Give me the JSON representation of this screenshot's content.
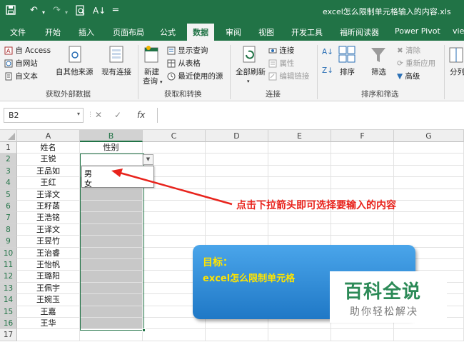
{
  "app": {
    "window_title": "excel怎么限制单元格输入的内容.xls",
    "quick_access": {
      "save_icon": "save-icon",
      "undo_icon": "undo-icon",
      "redo_icon": "redo-icon",
      "print_preview_icon": "print-preview-icon",
      "sort_icon": "sort-icon",
      "customize_icon": "customize-qat-icon"
    }
  },
  "tabs": [
    {
      "label": "文件"
    },
    {
      "label": "开始"
    },
    {
      "label": "插入"
    },
    {
      "label": "页面布局"
    },
    {
      "label": "公式"
    },
    {
      "label": "数据",
      "active": true
    },
    {
      "label": "审阅"
    },
    {
      "label": "视图"
    },
    {
      "label": "开发工具"
    },
    {
      "label": "福昕阅读器"
    },
    {
      "label": "Power Pivot"
    },
    {
      "label": "vie"
    }
  ],
  "ribbon": {
    "get_external": {
      "access": "自 Access",
      "web": "自网站",
      "text": "自文本",
      "other": "自其他来源",
      "existing": "现有连接",
      "group_label": "获取外部数据"
    },
    "get_transform": {
      "new_query": "新建",
      "new_query_sub": "查询",
      "show_queries": "显示查询",
      "from_table": "从表格",
      "recent": "最近使用的源",
      "group_label": "获取和转换"
    },
    "connections": {
      "refresh_all": "全部刷新",
      "connections": "连接",
      "properties": "属性",
      "edit_links": "编辑链接",
      "group_label": "连接"
    },
    "sort_filter": {
      "sort": "排序",
      "filter": "筛选",
      "clear": "清除",
      "reapply": "重新应用",
      "advanced": "高级",
      "group_label": "排序和筛选"
    },
    "data_tools": {
      "split": "分列"
    }
  },
  "formula_bar": {
    "name_box": "B2",
    "cancel_symbol": "✕",
    "enter_symbol": "✓",
    "fx_symbol": "fx",
    "content": ""
  },
  "columns": [
    "A",
    "B",
    "C",
    "D",
    "E",
    "F",
    "G"
  ],
  "rows": [
    "1",
    "2",
    "3",
    "4",
    "5",
    "6",
    "7",
    "8",
    "9",
    "10",
    "11",
    "12",
    "13",
    "14",
    "15",
    "16",
    "17"
  ],
  "column_a": [
    "姓名",
    "王锐",
    "王品如",
    "王红",
    "王译文",
    "王籽菡",
    "王浩铭",
    "王译文",
    "王昱竹",
    "王治睿",
    "王怡帆",
    "王璐阳",
    "王佩宇",
    "王婉玉",
    "王嘉",
    "王华",
    ""
  ],
  "b1": "性别",
  "dropdown": {
    "options": [
      "男",
      "女"
    ]
  },
  "annotation": "点击下拉箭头即可选择要输入的内容",
  "goal_box": {
    "title": "目标：",
    "text": "excel怎么限制单元格"
  },
  "watermark": {
    "title": "百科全说",
    "subtitle": "助你轻松解决"
  },
  "colors": {
    "accent": "#217346",
    "annotation": "#e8231c",
    "goal_text": "#ffe400"
  }
}
